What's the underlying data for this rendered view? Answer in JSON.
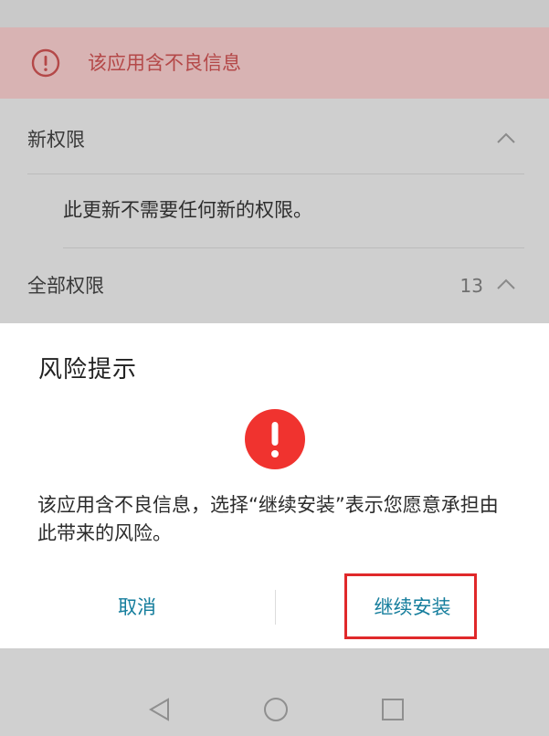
{
  "warning_banner": {
    "text": "该应用含不良信息",
    "icon": "alert-circle-icon",
    "color": "#b44848"
  },
  "sections": {
    "new_permissions": {
      "label": "新权限",
      "note": "此更新不需要任何新的权限。"
    },
    "all_permissions": {
      "label": "全部权限",
      "count": "13"
    }
  },
  "dialog": {
    "title": "风险提示",
    "icon": "alert-icon",
    "message": "该应用含不良信息，选择“继续安装”表示您愿意承担由此带来的风险。",
    "cancel_label": "取消",
    "continue_label": "继续安装",
    "accent_color": "#147d9c",
    "alert_color": "#f0332f"
  },
  "nav_bar": {
    "buttons": [
      "back-icon",
      "home-icon",
      "recents-icon"
    ]
  }
}
